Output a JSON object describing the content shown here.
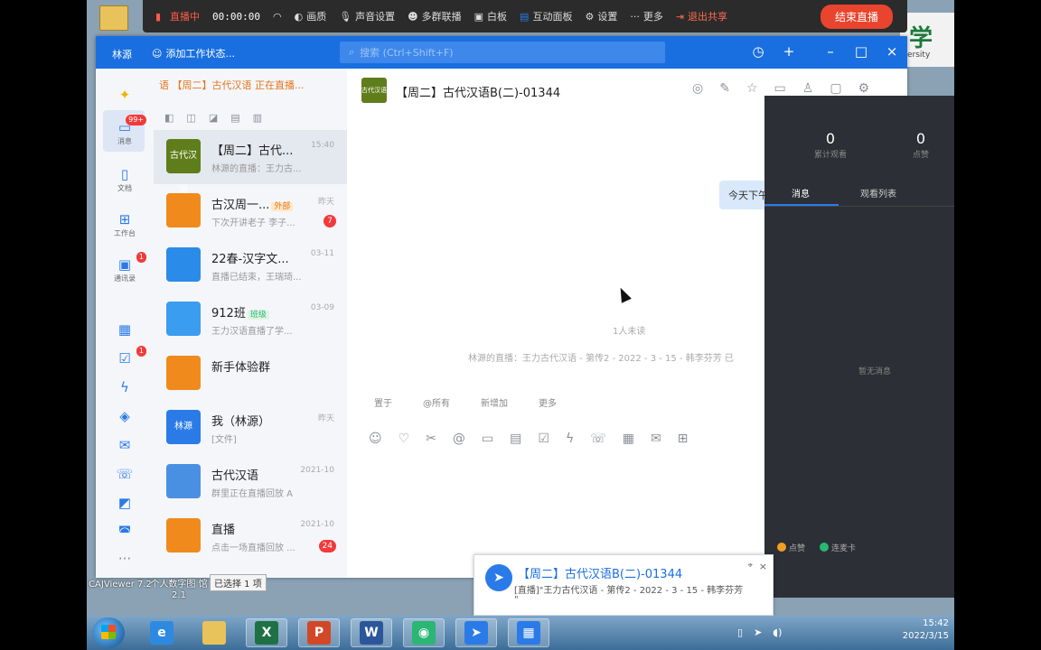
{
  "live_bar": {
    "status": "直播中",
    "timer": "00:00:00",
    "items": [
      "画质",
      "声音设置",
      "多群联播",
      "白板",
      "互动面板",
      "设置",
      "更多"
    ],
    "exit_share": "退出共享",
    "end_live": "结束直播"
  },
  "window": {
    "user": "林源",
    "status_label": "添加工作状态...",
    "search_placeholder": "搜索 (Ctrl+Shift+F)"
  },
  "rail": {
    "messages_badge": "99+",
    "messages_label": "消息",
    "docs_label": "文档",
    "workbench_label": "工作台",
    "contacts_label": "通讯录",
    "contacts_badge": "1",
    "todo_badge": "1",
    "more_label": "···"
  },
  "convlist": {
    "header": "语 【周二】古代汉语 正在直播...",
    "conversations": [
      {
        "name": "【周二】古代...",
        "time": "15:40",
        "preview": "林源的直播：王力古...",
        "avatar_text": "古代汉语",
        "avatar_color": "#5f7d1a"
      },
      {
        "name": "古汉周一...",
        "time": "昨天",
        "preview": "下次开讲老子 李子...",
        "badge": "7",
        "avatar_text": "",
        "avatar_color": "#f08a1c",
        "tag": "外部"
      },
      {
        "name": "22春-汉字文...",
        "time": "03-11",
        "preview": "直播已结束，王瑞琦...",
        "avatar_text": "",
        "avatar_color": "#2a8be8"
      },
      {
        "name": "912班",
        "time": "03-09",
        "preview": "王力汉语直播了学...",
        "avatar_text": "",
        "avatar_color": "#3a9df0",
        "tag": "班级"
      },
      {
        "name": "新手体验群",
        "time": "",
        "preview": "",
        "avatar_text": "",
        "avatar_color": "#f08a1c"
      },
      {
        "name": "我（林源）",
        "time": "昨天",
        "preview": "[文件]",
        "avatar_text": "林源",
        "avatar_color": "#2a7be8"
      },
      {
        "name": "古代汉语",
        "time": "2021-10",
        "preview": "群里正在直播回放 A",
        "avatar_text": "",
        "avatar_color": "#4a90e2"
      },
      {
        "name": "直播",
        "time": "2021-10",
        "preview": "点击一场直播回放 ...",
        "badge": "24",
        "avatar_text": "",
        "avatar_color": "#f08a1c"
      }
    ]
  },
  "chat": {
    "title": "【周二】古代汉语B(二)-01344",
    "avatar_text": "古代汉语",
    "bubble": "今天下午",
    "unread": "1人未读",
    "notice": "林源的直播：王力古代汉语 - 第传2 - 2022 - 3 - 15 - 韩李芬芳 已",
    "quick_actions": [
      "置于",
      "@所有",
      "新增加",
      "更多"
    ]
  },
  "dark_panel": {
    "stats": [
      {
        "value": "0",
        "label": "累计观看"
      },
      {
        "value": "0",
        "label": "点赞"
      }
    ],
    "tabs": [
      "消息",
      "观看列表"
    ],
    "center": "暂无消息",
    "bottom": [
      "点赞",
      "连麦卡"
    ]
  },
  "toast": {
    "title": "【周二】古代汉语B(二)-01344",
    "line1": "[直播]\"王力古代汉语 - 第传2 - 2022 - 3 - 15 - 韩李芬芳",
    "line2": "\""
  },
  "desktop": {
    "label1": "CAJViewer 7.2",
    "label2": "个人数字图 馆2.1",
    "selection_tip": "已选择 1 项",
    "logo_char": "学",
    "logo_text": "ersity"
  },
  "taskbar": {
    "apps": [
      "IE",
      "文件夹",
      "Excel",
      "PowerPoint",
      "Word",
      "微信",
      "钉钉",
      "日历"
    ],
    "time": "15:42",
    "date": "2022/3/15"
  }
}
